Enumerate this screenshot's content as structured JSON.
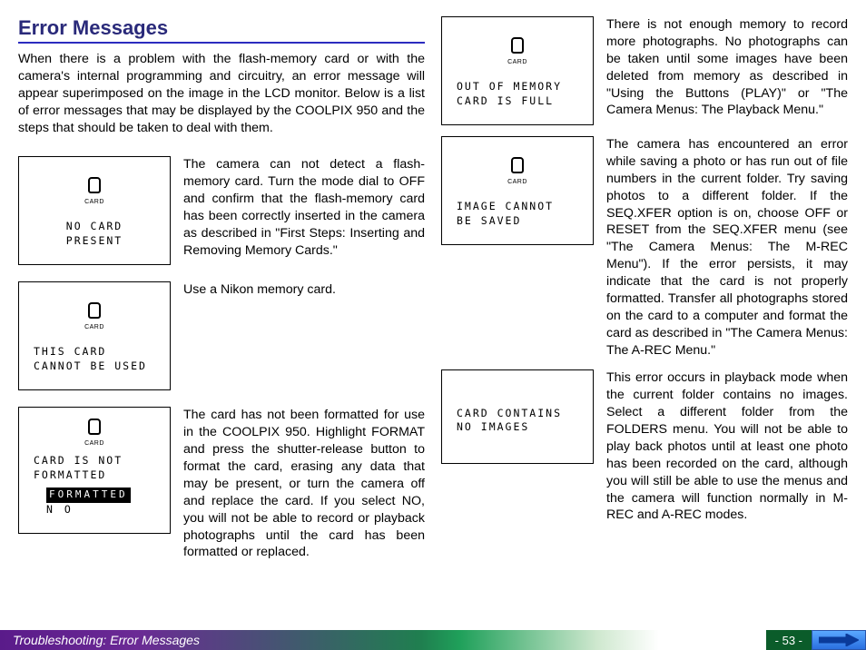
{
  "title": "Error Messages",
  "intro": "When there is a problem with the flash-memory card or with the camera's internal programming and circuitry, an error message will appear superimposed on the image in the LCD monitor.  Below is a list of error messages that may be displayed by the COOLPIX 950 and the steps that should be taken to deal with them.",
  "card_label": "CARD",
  "left": [
    {
      "msg": "NO CARD\nPRESENT",
      "desc": "The camera can not detect a flash-memory card.  Turn the mode dial to OFF and confirm that the flash-memory card has been correctly inserted in the camera as described in \"First Steps: Inserting and Removing Memory Cards.\""
    },
    {
      "msg": "THIS CARD\nCANNOT BE USED",
      "desc": "Use a Nikon memory card."
    },
    {
      "msg": "CARD IS NOT\nFORMATTED",
      "opt_hi": "FORMATTED",
      "opt_lo": "N O",
      "desc": "The card has not been formatted for use in the COOLPIX 950.  Highlight FORMAT and press the shutter-release button to format the card, erasing any data that may be present, or turn the camera off and replace the card.  If you select NO, you will not be able to record or playback photographs until the card has been formatted or replaced."
    }
  ],
  "right": [
    {
      "msg": "OUT OF MEMORY\nCARD IS FULL",
      "desc": "There is not enough memory to record more photographs.  No photographs can be taken until some images have been deleted from memory as described in \"Using the Buttons (PLAY)\" or \"The Camera Menus: The Playback Menu.\""
    },
    {
      "msg": "IMAGE CANNOT\nBE SAVED",
      "desc": "The camera has encountered an error while saving a photo or has run out of file numbers in the current folder.  Try saving photos to a different folder.  If the SEQ.XFER option is on, choose OFF or RESET from the SEQ.XFER menu (see \"The Camera Menus: The M-REC Menu\").  If the error persists, it may indicate that the card is not properly formatted.  Transfer all photographs stored on the card to a computer and format the card as described in \"The Camera Menus: The A-REC Menu.\""
    },
    {
      "msg": "CARD CONTAINS\nNO IMAGES",
      "desc": "This error occurs in playback mode when the current folder contains no images.  Select a different folder from the FOLDERS menu.  You will not be able to play back photos until at least one photo has been recorded on the card, although you will still be able to use the menus and the camera will function normally in M-REC and A-REC modes."
    }
  ],
  "footer": {
    "section": "Troubleshooting: Error Messages",
    "page": "- 53 -"
  }
}
